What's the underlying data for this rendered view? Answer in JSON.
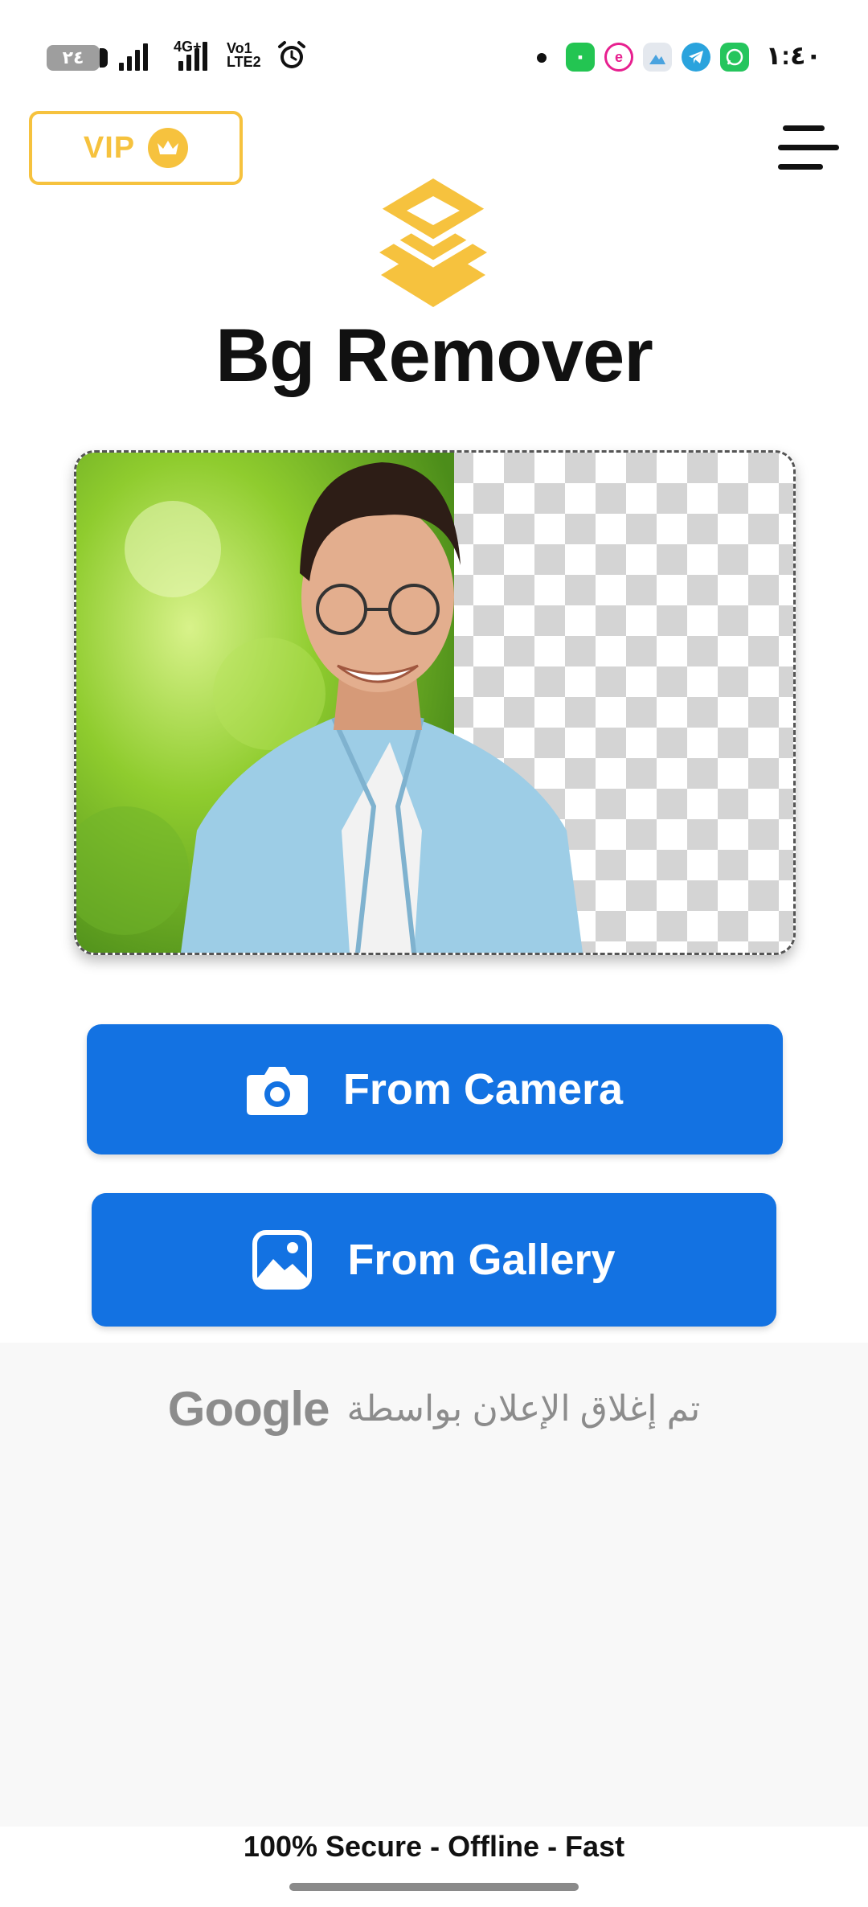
{
  "status_bar": {
    "battery": "٢٤",
    "network_4g": "4G+",
    "volte_top": "Vo",
    "volte_bottom": "LTE",
    "sim1": "1",
    "sim2": "2",
    "time": "١:٤٠",
    "icons": [
      "alarm-icon",
      "notification-dot",
      "app-icon-green",
      "app-icon-pink",
      "app-icon-mountain",
      "telegram-icon",
      "whatsapp-icon"
    ]
  },
  "header": {
    "vip_label": "VIP",
    "menu_icon": "hamburger-menu-icon"
  },
  "app": {
    "title": "Bg Remover"
  },
  "actions": {
    "camera_label": "From Camera",
    "gallery_label": "From Gallery"
  },
  "ad": {
    "brand": "Google",
    "message": "تم إغلاق الإعلان بواسطة"
  },
  "footer": {
    "tagline": "100% Secure - Offline - Fast"
  },
  "colors": {
    "accent_blue": "#1372e2",
    "vip_gold": "#f6c23e"
  }
}
